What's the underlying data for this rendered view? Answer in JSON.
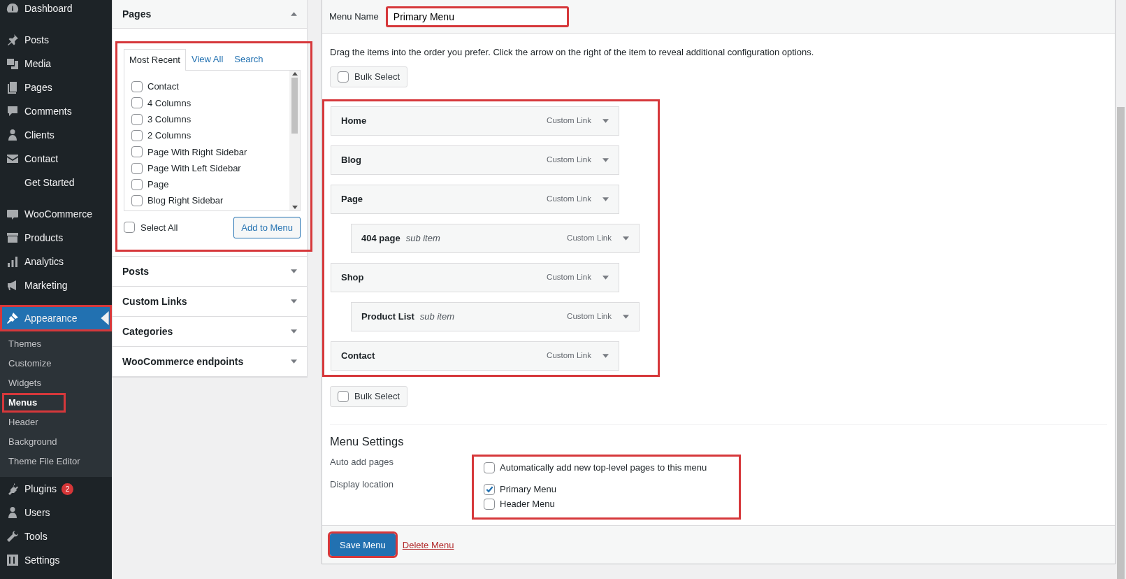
{
  "sidebar": {
    "groups": [
      [
        {
          "label": "Dashboard",
          "selected": false,
          "highlighted": false
        }
      ],
      [
        {
          "label": "Posts",
          "selected": false,
          "highlighted": false
        },
        {
          "label": "Media",
          "selected": false,
          "highlighted": false
        },
        {
          "label": "Pages",
          "selected": false,
          "highlighted": false
        },
        {
          "label": "Comments",
          "selected": false,
          "highlighted": false
        },
        {
          "label": "Clients",
          "selected": false,
          "highlighted": false
        },
        {
          "label": "Contact",
          "selected": false,
          "highlighted": false
        },
        {
          "label": "Get Started",
          "selected": false,
          "highlighted": false
        }
      ],
      [
        {
          "label": "WooCommerce",
          "selected": false,
          "highlighted": false
        },
        {
          "label": "Products",
          "selected": false,
          "highlighted": false
        },
        {
          "label": "Analytics",
          "selected": false,
          "highlighted": false
        },
        {
          "label": "Marketing",
          "selected": false,
          "highlighted": false
        }
      ],
      [
        {
          "label": "Appearance",
          "selected": true,
          "highlighted": true,
          "children": [
            {
              "label": "Themes",
              "selected": false,
              "highlighted": false
            },
            {
              "label": "Customize",
              "selected": false,
              "highlighted": false
            },
            {
              "label": "Widgets",
              "selected": false,
              "highlighted": false
            },
            {
              "label": "Menus",
              "selected": true,
              "highlighted": true
            },
            {
              "label": "Header",
              "selected": false,
              "highlighted": false
            },
            {
              "label": "Background",
              "selected": false,
              "highlighted": false
            },
            {
              "label": "Theme File Editor",
              "selected": false,
              "highlighted": false
            }
          ]
        },
        {
          "label": "Plugins",
          "selected": false,
          "highlighted": false,
          "badge": "2"
        },
        {
          "label": "Users",
          "selected": false,
          "highlighted": false
        },
        {
          "label": "Tools",
          "selected": false,
          "highlighted": false
        },
        {
          "label": "Settings",
          "selected": false,
          "highlighted": false
        }
      ]
    ]
  },
  "add_panel": {
    "sections": [
      {
        "title": "Pages",
        "expanded": true,
        "highlighted": true,
        "tabs": [
          {
            "label": "Most Recent",
            "selected": true
          },
          {
            "label": "View All",
            "selected": false
          },
          {
            "label": "Search",
            "selected": false
          }
        ],
        "items": [
          {
            "label": "Contact",
            "checked": false
          },
          {
            "label": "4 Columns",
            "checked": false
          },
          {
            "label": "3 Columns",
            "checked": false
          },
          {
            "label": "2 Columns",
            "checked": false
          },
          {
            "label": "Page With Right Sidebar",
            "checked": false
          },
          {
            "label": "Page With Left Sidebar",
            "checked": false
          },
          {
            "label": "Page",
            "checked": false
          },
          {
            "label": "Blog Right Sidebar",
            "checked": false
          }
        ],
        "select_all": {
          "label": "Select All",
          "checked": false
        },
        "button": "Add to Menu"
      },
      {
        "title": "Posts",
        "expanded": false,
        "highlighted": false
      },
      {
        "title": "Custom Links",
        "expanded": false,
        "highlighted": false
      },
      {
        "title": "Categories",
        "expanded": false,
        "highlighted": false
      },
      {
        "title": "WooCommerce endpoints",
        "expanded": false,
        "highlighted": false
      }
    ]
  },
  "menu_name": {
    "label": "Menu Name",
    "value": "Primary Menu",
    "highlighted": true
  },
  "instructions": "Drag the items into the order you prefer. Click the arrow on the right of the item to reveal additional configuration options.",
  "bulk_select_top": {
    "label": "Bulk Select",
    "checked": false
  },
  "menu_structure": {
    "highlighted": true,
    "items": [
      {
        "title": "Home",
        "type": "Custom Link"
      },
      {
        "title": "Blog",
        "type": "Custom Link"
      },
      {
        "title": "Page",
        "type": "Custom Link",
        "children": [
          {
            "title": "404 page",
            "note": "sub item",
            "type": "Custom Link"
          }
        ]
      },
      {
        "title": "Shop",
        "type": "Custom Link",
        "children": [
          {
            "title": "Product List",
            "note": "sub item",
            "type": "Custom Link"
          }
        ]
      },
      {
        "title": "Contact",
        "type": "Custom Link"
      }
    ]
  },
  "bulk_select_bottom": {
    "label": "Bulk Select",
    "checked": false
  },
  "menu_settings": {
    "heading": "Menu Settings",
    "highlighted": true,
    "rows": [
      {
        "label": "Auto add pages",
        "options": [
          {
            "label": "Automatically add new top-level pages to this menu",
            "checked": false
          }
        ]
      },
      {
        "label": "Display location",
        "options": [
          {
            "label": "Primary Menu",
            "checked": true
          },
          {
            "label": "Header Menu",
            "checked": false
          }
        ]
      }
    ]
  },
  "footer": {
    "save": {
      "label": "Save Menu",
      "highlighted": true
    },
    "delete": "Delete Menu"
  }
}
